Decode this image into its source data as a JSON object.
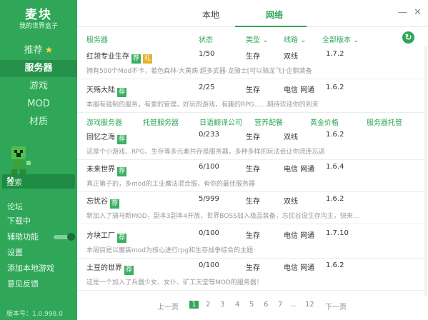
{
  "app": {
    "title": "麦块",
    "subtitle": "我的世界盒子",
    "version": "版本号：1.0.998.0"
  },
  "sidebar": {
    "nav": [
      {
        "label": "推荐"
      },
      {
        "label": "服务器"
      },
      {
        "label": "游戏"
      },
      {
        "label": "MOD"
      },
      {
        "label": "材质"
      }
    ],
    "search_label": "搜索",
    "links": [
      {
        "label": "论坛"
      },
      {
        "label": "下载中"
      },
      {
        "label": "辅助功能"
      },
      {
        "label": "设置"
      },
      {
        "label": "添加本地游戏"
      },
      {
        "label": "意见反馈"
      }
    ]
  },
  "tabs": {
    "local": "本地",
    "network": "网络"
  },
  "window": {
    "minimize": "—",
    "close": "✕"
  },
  "headers": {
    "name": "服务器",
    "status": "状态",
    "type": "类型",
    "route": "线路",
    "version": "全部版本"
  },
  "rows": [
    {
      "name": "红领专业生存",
      "status": "1/50",
      "type": "生存",
      "route": "双线",
      "version": "1.7.2",
      "desc": "拥有500个Mod不卡，着色森林·大黄病·超多武器·龙骑士[可以骑龙飞]·企鹅装备"
    },
    {
      "name": "天殇大陆",
      "status": "2/25",
      "type": "生存",
      "route": "电信 网通",
      "version": "1.6.2",
      "desc": "本服有强制的服务，有爱的管理，好玩的游戏，有趣的RPG……期待欢迎你的到来"
    },
    {
      "name": "回忆之海",
      "status": "0/233",
      "type": "生存",
      "route": "双线",
      "version": "1.6.2",
      "desc": "这是个小游戏、RPG、生存等多元素共存是服务器，多种多样的玩法会让你流连忘返"
    },
    {
      "name": "未来世界",
      "status": "6/100",
      "type": "生存",
      "route": "电信 网通",
      "version": "1.6.4",
      "desc": "真正第子的，多mod的工业魔法混合服，有你的最佳服务器"
    },
    {
      "name": "忘忧谷",
      "status": "5/999",
      "type": "生存",
      "route": "双线",
      "version": "1.6.2",
      "desc": "新加入了骑马新MOD，副本3副本4开放，世界BOSS加入极品装备，忘忧谷设生存沟主，快来…"
    },
    {
      "name": "方块工厂",
      "status": "0/100",
      "type": "生存",
      "route": "电信 网通",
      "version": "1.7.10",
      "desc": "本周目是以魔装mod为核心进行rpg和生存战争综合的主题"
    },
    {
      "name": "土豆的世界",
      "status": "0/100",
      "type": "生存",
      "route": "电信 网通",
      "version": "1.6.2",
      "desc": "这是一个加入了兵器少女、女仆、矿工天堂等MOD的服务器！"
    }
  ],
  "badges": {
    "recommend": "荐",
    "gift": "礼"
  },
  "ads": [
    {
      "label": "游戏服务器"
    },
    {
      "label": "托管服务器"
    },
    {
      "label": "日语翻译公司"
    },
    {
      "label": "营养配餐"
    },
    {
      "label": "黄金价格"
    },
    {
      "label": "服务器托管"
    }
  ],
  "pagination": {
    "prev": "上一页",
    "pages": [
      "1",
      "2",
      "3",
      "4",
      "5",
      "6",
      "7"
    ],
    "ellipsis": "...",
    "last": "12",
    "next": "下一页"
  },
  "colors": {
    "accent": "#2fa658",
    "badge": "#3bb063",
    "gift": "#e6b22d"
  }
}
